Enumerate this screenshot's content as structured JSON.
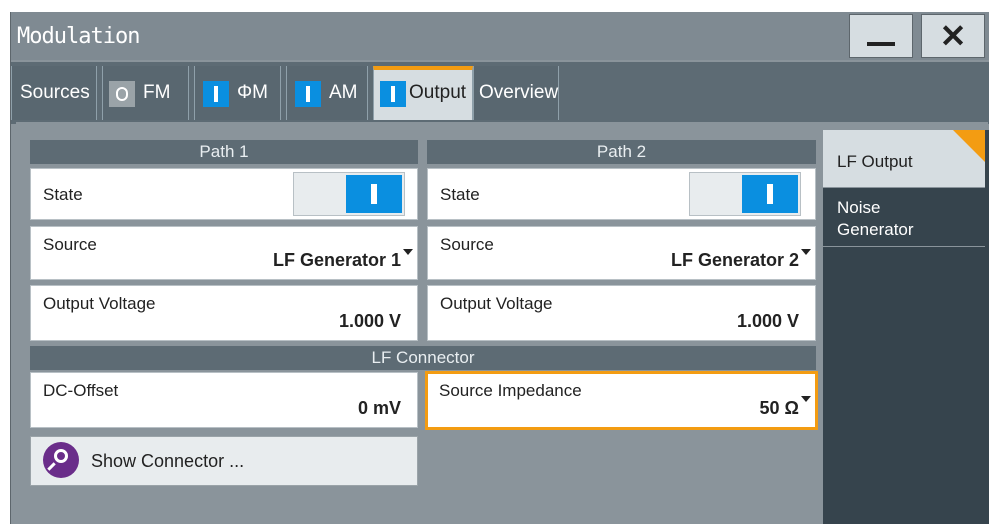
{
  "window": {
    "title": "Modulation",
    "minimize_label": "",
    "close_label": "✕"
  },
  "tabs": [
    {
      "label": "Sources",
      "indicator": "none"
    },
    {
      "label": "FM",
      "indicator": "off"
    },
    {
      "label": "ΦM",
      "indicator": "on"
    },
    {
      "label": "AM",
      "indicator": "on"
    },
    {
      "label": "Output",
      "indicator": "on",
      "active": true
    },
    {
      "label": "Overview",
      "indicator": "none"
    }
  ],
  "path1": {
    "header": "Path 1",
    "state_label": "State",
    "state_on": true,
    "source_label": "Source",
    "source_value": "LF Generator 1",
    "voltage_label": "Output Voltage",
    "voltage_value": "1.000 V"
  },
  "path2": {
    "header": "Path 2",
    "state_label": "State",
    "state_on": true,
    "source_label": "Source",
    "source_value": "LF Generator 2",
    "voltage_label": "Output Voltage",
    "voltage_value": "1.000 V"
  },
  "connector": {
    "header": "LF Connector",
    "dc_offset_label": "DC-Offset",
    "dc_offset_value": "0 mV",
    "impedance_label": "Source Impedance",
    "impedance_value": "50 Ω",
    "show_button_label": "Show Connector ..."
  },
  "side_panel": {
    "items": [
      {
        "label": "LF Output",
        "active": true
      },
      {
        "label": "Noise\nGenerator",
        "active": false
      }
    ]
  },
  "colors": {
    "accent": "#f39c12",
    "on_indicator": "#0a8fe0",
    "header_bg": "#5d6b74",
    "side_bg": "#36444d"
  }
}
